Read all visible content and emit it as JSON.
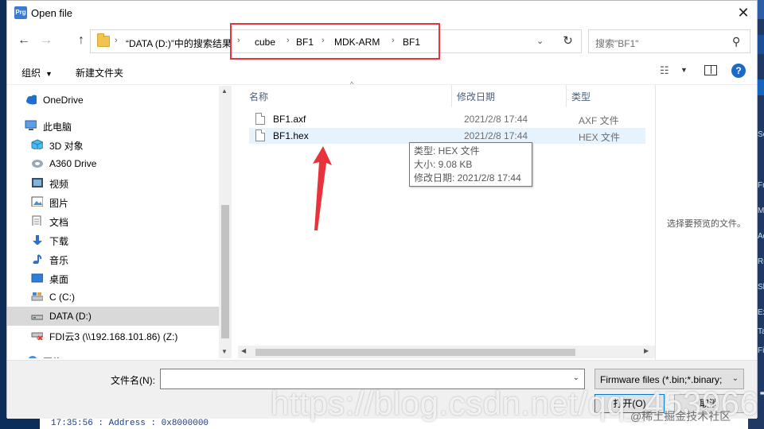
{
  "window": {
    "title": "Open file",
    "app_icon_text": "Prg",
    "close_glyph": "✕"
  },
  "nav": {
    "back": "←",
    "forward": "→",
    "up": "↑",
    "crumbs": [
      "“DATA (D:)”中的搜索结果",
      "cube",
      "BF1",
      "MDK-ARM",
      "BF1"
    ],
    "separator": "›",
    "dropdown": "⌄",
    "refresh": "↻",
    "search_placeholder": "搜索\"BF1\"",
    "search_glyph": "⚲"
  },
  "toolbar": {
    "organize": "组织",
    "organize_caret": "▼",
    "new_folder": "新建文件夹",
    "view_glyph": "☷",
    "view_caret": "▼",
    "help": "?"
  },
  "sidebar": {
    "items": [
      {
        "label": "OneDrive",
        "icon": "cloud-icon"
      },
      {
        "label": "此电脑",
        "icon": "computer-icon"
      },
      {
        "label": "3D 对象",
        "icon": "cube-3d-icon"
      },
      {
        "label": "A360 Drive",
        "icon": "a360-drive-icon"
      },
      {
        "label": "视频",
        "icon": "video-icon"
      },
      {
        "label": "图片",
        "icon": "picture-icon"
      },
      {
        "label": "文档",
        "icon": "document-icon"
      },
      {
        "label": "下载",
        "icon": "download-icon"
      },
      {
        "label": "音乐",
        "icon": "music-icon"
      },
      {
        "label": "桌面",
        "icon": "desktop-icon"
      },
      {
        "label": "C (C:)",
        "icon": "drive-icon"
      },
      {
        "label": "DATA (D:)",
        "icon": "drive-icon"
      },
      {
        "label": "FDI云3 (\\\\192.168.101.86) (Z:)",
        "icon": "network-drive-icon"
      },
      {
        "label": "网络",
        "icon": "network-icon"
      }
    ],
    "selected_index": 11
  },
  "filelist": {
    "columns": [
      "名称",
      "修改日期",
      "类型"
    ],
    "sort_glyph": "^",
    "files": [
      {
        "name": "BF1.axf",
        "date": "2021/2/8 17:44",
        "type": "AXF 文件"
      },
      {
        "name": "BF1.hex",
        "date": "2021/2/8 17:44",
        "type": "HEX 文件"
      }
    ]
  },
  "tooltip": {
    "type": "类型: HEX 文件",
    "size": "大小: 9.08 KB",
    "modified": "修改日期: 2021/2/8 17:44"
  },
  "preview": {
    "text": "选择要预览的文件。"
  },
  "bottom": {
    "filename_label": "文件名(N):",
    "filename_value": "",
    "filter": "Firmware files (*.bin;*.binary;",
    "open": "打开(O)",
    "cancel": "取消",
    "dd": "⌄"
  },
  "background": {
    "log_line": "17:35:56 : Address : 0x8000000",
    "side_letters": [
      "Se",
      "Fr",
      "M",
      "Ad",
      "Re",
      "Sh",
      "Ex",
      "Ta",
      "Fi"
    ]
  },
  "watermark": {
    "url": "https://blog.csdn.net/qq_45396672",
    "site": "@稀土掘金技术社区"
  },
  "colors": {
    "highlight": "#e8323c",
    "arrow": "#e8323c",
    "accent": "#0078d7",
    "selected": "#d9d9d9",
    "hover": "#e5f3ff"
  }
}
